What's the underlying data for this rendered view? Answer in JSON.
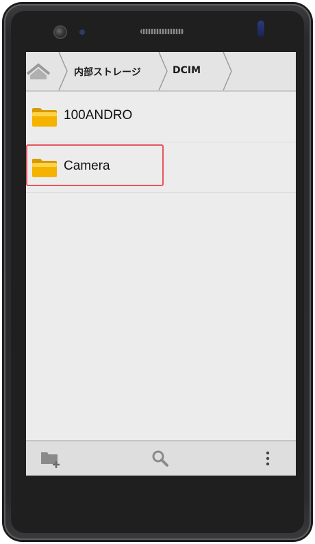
{
  "breadcrumb": {
    "items": [
      {
        "label": "内部ストレージ"
      },
      {
        "label": "DCIM"
      }
    ]
  },
  "files": [
    {
      "name": "100ANDRO",
      "icon": "folder-icon"
    },
    {
      "name": "Camera",
      "icon": "folder-icon",
      "highlighted": true
    }
  ],
  "toolbar": {
    "icons": [
      "new-folder-icon",
      "search-icon",
      "more-vert-icon"
    ]
  },
  "colors": {
    "folder": "#f5b300",
    "highlight": "#e8545e",
    "screen_bg": "#ececec"
  }
}
